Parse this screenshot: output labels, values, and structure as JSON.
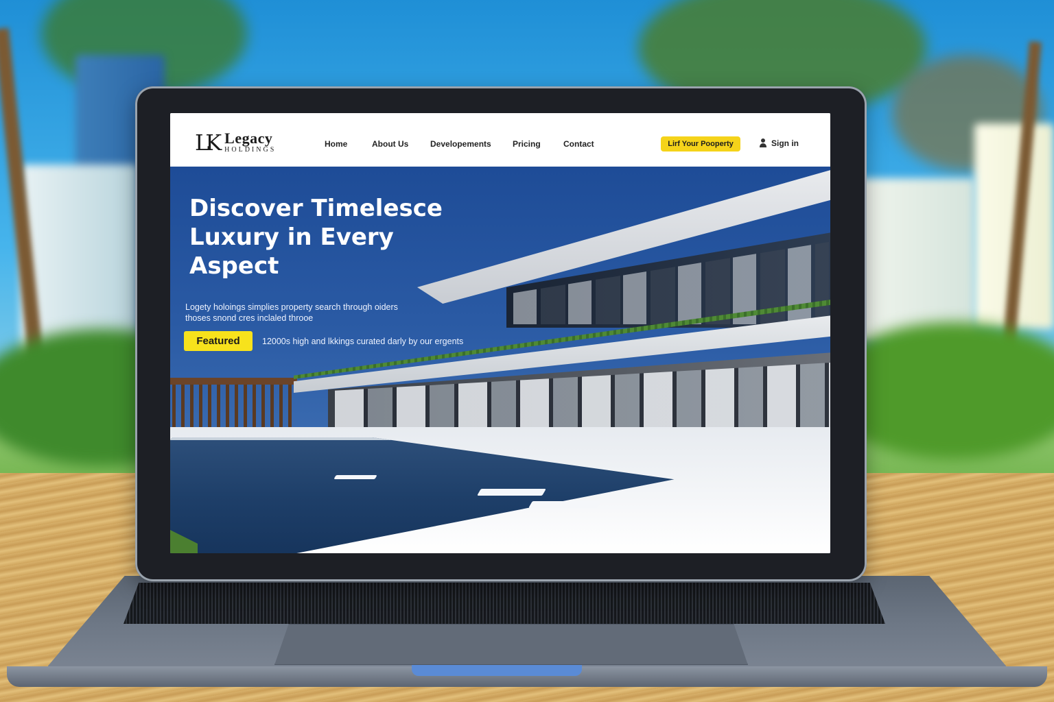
{
  "brand": {
    "monogram": "LK",
    "name": "Legacy",
    "subtitle": "HOLDINGS"
  },
  "nav": {
    "items": [
      {
        "label": "Home"
      },
      {
        "label": "About Us"
      },
      {
        "label": "Developements"
      },
      {
        "label": "Pricing"
      },
      {
        "label": "Contact"
      }
    ],
    "cta_label": "Lirf Your Pooperty",
    "signin_label": "Sign in"
  },
  "hero": {
    "title": "Discover Timelesce Luxury in Every Aspect",
    "description": "Logety holoings simplies property search through oiders thoses snond cres inclaled throoe",
    "badge": "Featured",
    "featured_text": "12000s high and lkkings curated darly by our ergents"
  },
  "colors": {
    "accent_yellow": "#f5d31a",
    "hero_blue": "#1e4c97",
    "header_bg": "#ffffff"
  },
  "icons": {
    "signin": "user-icon"
  }
}
